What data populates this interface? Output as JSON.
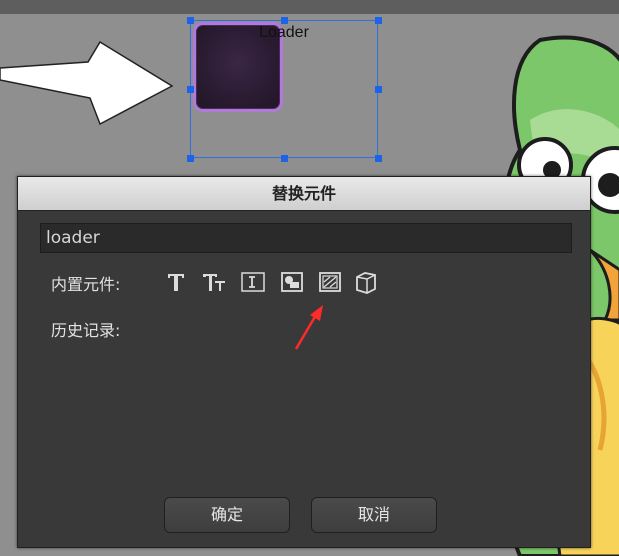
{
  "stage": {
    "component_label": "Loader"
  },
  "dialog": {
    "title": "替换元件",
    "search": {
      "value": "loader"
    },
    "builtin_label": "内置元件:",
    "history_label": "历史记录:",
    "builtin_icons": [
      "text-icon",
      "text-input-icon",
      "text-area-icon",
      "image-icon",
      "loader-icon",
      "3d-icon"
    ],
    "confirm_label": "确定",
    "cancel_label": "取消"
  },
  "colors": {
    "accent_selection": "#1c63e8",
    "loader_border": "#b07ad8",
    "dialog_bg": "#393939",
    "annotation_arrow": "#ff2a2a"
  }
}
